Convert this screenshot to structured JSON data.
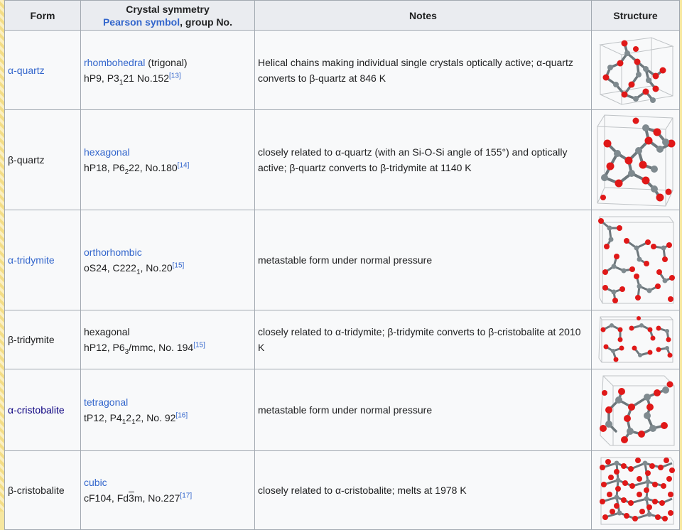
{
  "header": {
    "form": "Form",
    "symmetry_line1": "Crystal symmetry",
    "pearson_link": "Pearson symbol",
    "symmetry_suffix": ", group No.",
    "notes": "Notes",
    "structure": "Structure"
  },
  "rows": [
    {
      "form": "α-quartz",
      "system": "rhombohedral",
      "system_extra": " (trigonal)",
      "pearson": "hP9, P3",
      "sub1": "1",
      "sg_rest": "21 No.152",
      "ref": "[13]",
      "notes": "Helical chains making individual single crystals optically active; α-quartz converts to β-quartz at 846 K",
      "structure_icon": "alpha-quartz-structure"
    },
    {
      "form": "β-quartz",
      "system": "hexagonal",
      "pearson": "hP18, P6",
      "sub1": "2",
      "sg_rest": "22, No.180",
      "ref": "[14]",
      "notes": "closely related to α-quartz (with an Si-O-Si angle of 155°) and optically active; β-quartz converts to β-tridymite at 1140 K",
      "structure_icon": "beta-quartz-structure"
    },
    {
      "form": "α-tridymite",
      "system": "orthorhombic",
      "pearson": "oS24, C222",
      "sub1": "1",
      "sg_rest": ", No.20",
      "ref": "[15]",
      "notes": "metastable form under normal pressure",
      "structure_icon": "alpha-tridymite-structure"
    },
    {
      "form": "β-tridymite",
      "system": "hexagonal",
      "pearson": "hP12, P6",
      "sub1": "3",
      "sg_rest": "/mmc, No. 194",
      "ref": "[15]",
      "notes": "closely related to α-tridymite; β-tridymite converts to β-cristobalite at 2010 K",
      "structure_icon": "beta-tridymite-structure"
    },
    {
      "form": "α-cristobalite",
      "system": "tetragonal",
      "pearson": "tP12, P4",
      "sub1": "1",
      "mid": "2",
      "sub2": "1",
      "sg_rest": "2, No. 92",
      "ref": "[16]",
      "notes": "metastable form under normal pressure",
      "structure_icon": "alpha-cristobalite-structure"
    },
    {
      "form": "β-cristobalite",
      "system": "cubic",
      "pearson": "cF104, Fd",
      "overline": "3",
      "sg_rest": "m, No.227",
      "ref": "[17]",
      "notes": "closely related to α-cristobalite; melts at 1978 K",
      "structure_icon": "beta-cristobalite-structure"
    }
  ],
  "colors": {
    "link": "#3366cc",
    "visited_link": "#0b0080",
    "header_bg": "#eaecf0",
    "cell_bg": "#f8f9fa",
    "border": "#a2a9b1",
    "oxygen": "#e01818",
    "silicon": "#7f8a8f"
  }
}
